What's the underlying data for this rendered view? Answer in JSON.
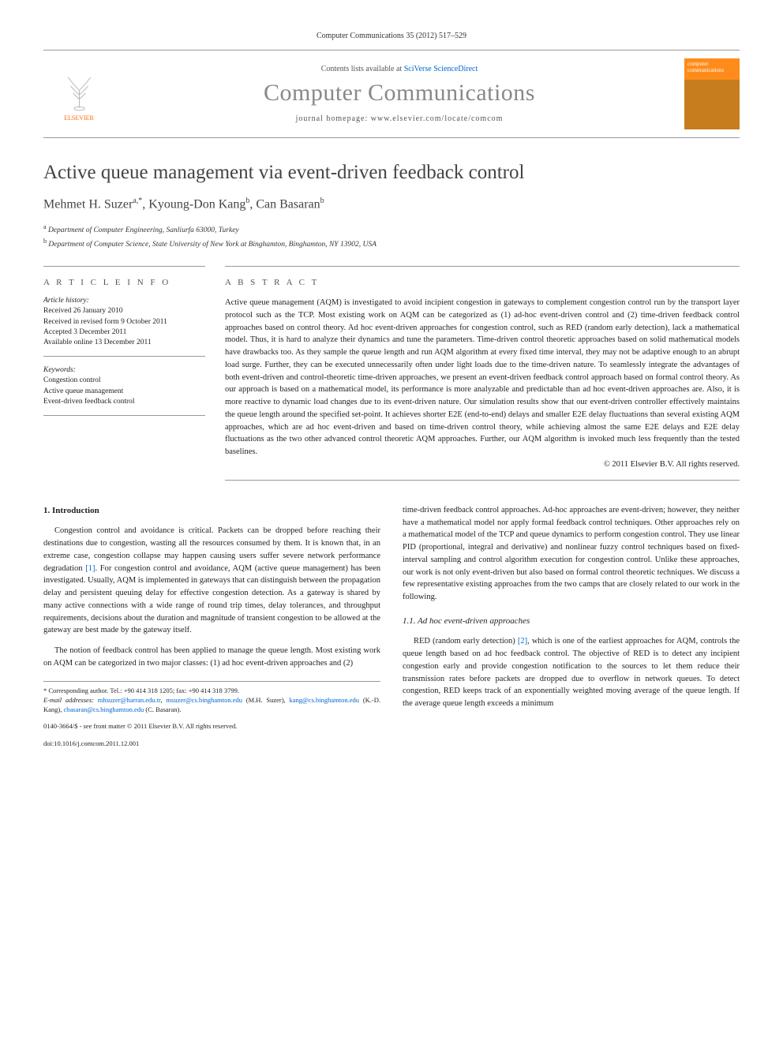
{
  "citation": "Computer Communications 35 (2012) 517–529",
  "masthead": {
    "contents_prefix": "Contents lists available at ",
    "contents_link": "SciVerse ScienceDirect",
    "journal": "Computer Communications",
    "homepage_label": "journal homepage: ",
    "homepage_url": "www.elsevier.com/locate/comcom",
    "publisher": "ELSEVIER",
    "cover_text": "computer communications"
  },
  "article": {
    "title": "Active queue management via event-driven feedback control",
    "authors_html": "Mehmet H. Suzer",
    "author1": "Mehmet H. Suzer",
    "aff1_sup": "a,",
    "corr": "*",
    "author2": "Kyoung-Don Kang",
    "aff2_sup": "b",
    "author3": "Can Basaran",
    "aff3_sup": "b",
    "affiliations": {
      "a": "Department of Computer Engineering, Sanliurfa 63000, Turkey",
      "b": "Department of Computer Science, State University of New York at Binghamton, Binghamton, NY 13902, USA"
    }
  },
  "info": {
    "heading": "A R T I C L E   I N F O",
    "history_label": "Article history:",
    "history": "Received 26 January 2010\nReceived in revised form 9 October 2011\nAccepted 3 December 2011\nAvailable online 13 December 2011",
    "keywords_label": "Keywords:",
    "keywords": "Congestion control\nActive queue management\nEvent-driven feedback control"
  },
  "abstract": {
    "heading": "A B S T R A C T",
    "text": "Active queue management (AQM) is investigated to avoid incipient congestion in gateways to complement congestion control run by the transport layer protocol such as the TCP. Most existing work on AQM can be categorized as (1) ad-hoc event-driven control and (2) time-driven feedback control approaches based on control theory. Ad hoc event-driven approaches for congestion control, such as RED (random early detection), lack a mathematical model. Thus, it is hard to analyze their dynamics and tune the parameters. Time-driven control theoretic approaches based on solid mathematical models have drawbacks too. As they sample the queue length and run AQM algorithm at every fixed time interval, they may not be adaptive enough to an abrupt load surge. Further, they can be executed unnecessarily often under light loads due to the time-driven nature. To seamlessly integrate the advantages of both event-driven and control-theoretic time-driven approaches, we present an event-driven feedback control approach based on formal control theory. As our approach is based on a mathematical model, its performance is more analyzable and predictable than ad hoc event-driven approaches are. Also, it is more reactive to dynamic load changes due to its event-driven nature. Our simulation results show that our event-driven controller effectively maintains the queue length around the specified set-point. It achieves shorter E2E (end-to-end) delays and smaller E2E delay fluctuations than several existing AQM approaches, which are ad hoc event-driven and based on time-driven control theory, while achieving almost the same E2E delays and E2E delay fluctuations as the two other advanced control theoretic AQM approaches. Further, our AQM algorithm is invoked much less frequently than the tested baselines.",
    "copyright": "© 2011 Elsevier B.V. All rights reserved."
  },
  "body": {
    "section1_heading": "1. Introduction",
    "para1": "Congestion control and avoidance is critical. Packets can be dropped before reaching their destinations due to congestion, wasting all the resources consumed by them. It is known that, in an extreme case, congestion collapse may happen causing users suffer severe network performance degradation [1]. For congestion control and avoidance, AQM (active queue management) has been investigated. Usually, AQM is implemented in gateways that can distinguish between the propagation delay and persistent queuing delay for effective congestion detection. As a gateway is shared by many active connections with a wide range of round trip times, delay tolerances, and throughput requirements, decisions about the duration and magnitude of transient congestion to be allowed at the gateway are best made by the gateway itself.",
    "para2": "The notion of feedback control has been applied to manage the queue length. Most existing work on AQM can be categorized in two major classes: (1) ad hoc event-driven approaches and (2)",
    "para3": "time-driven feedback control approaches. Ad-hoc approaches are event-driven; however, they neither have a mathematical model nor apply formal feedback control techniques. Other approaches rely on a mathematical model of the TCP and queue dynamics to perform congestion control. They use linear PID (proportional, integral and derivative) and nonlinear fuzzy control techniques based on fixed-interval sampling and control algorithm execution for congestion control. Unlike these approaches, our work is not only event-driven but also based on formal control theoretic techniques. We discuss a few representative existing approaches from the two camps that are closely related to our work in the following.",
    "subsection11_heading": "1.1. Ad hoc event-driven approaches",
    "para4": "RED (random early detection) [2], which is one of the earliest approaches for AQM, controls the queue length based on ad hoc feedback control. The objective of RED is to detect any incipient congestion early and provide congestion notification to the sources to let them reduce their transmission rates before packets are dropped due to overflow in network queues. To detect congestion, RED keeps track of an exponentially weighted moving average of the queue length. If the average queue length exceeds a minimum"
  },
  "footer": {
    "corresp": "* Corresponding author. Tel.: +90 414 318 1205; fax: +90 414 318 3799.",
    "email_label": "E-mail addresses:",
    "email1": "mhsuzer@harran.edu.tr",
    "email2": "msuzer@cs.binghamton.edu",
    "email_owner1": "(M.H. Suzer),",
    "email3": "kang@cs.binghamton.edu",
    "email_owner2": "(K.-D. Kang),",
    "email4": "cbasaran@cs.binghamton.edu",
    "email_owner3": "(C. Basaran).",
    "issn": "0140-3664/$ - see front matter © 2011 Elsevier B.V. All rights reserved.",
    "doi": "doi:10.1016/j.comcom.2011.12.001"
  }
}
